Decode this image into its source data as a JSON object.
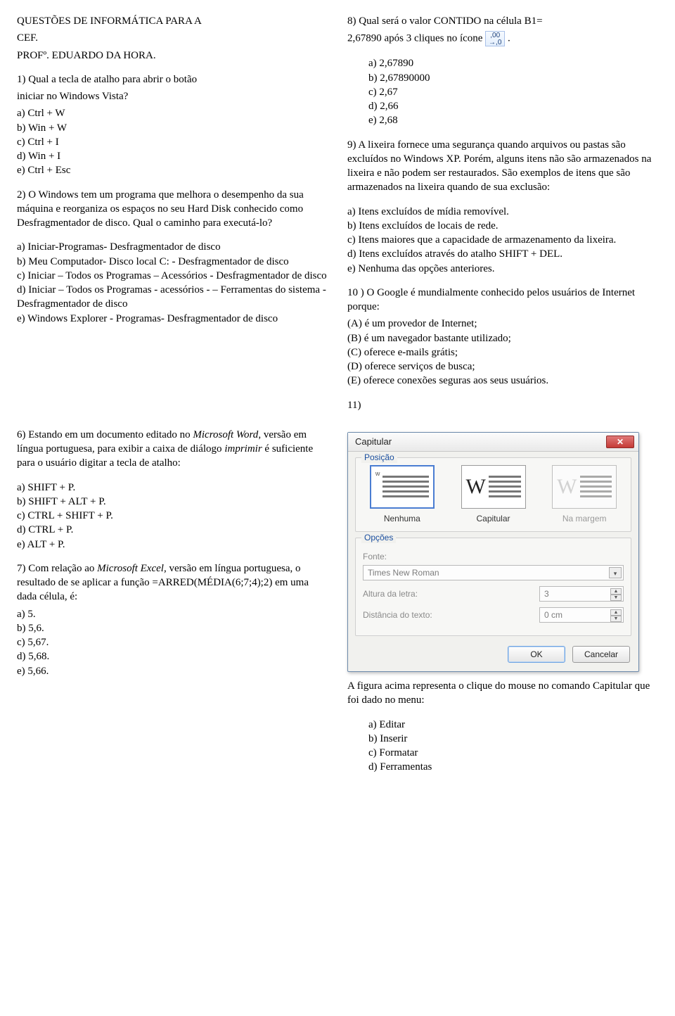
{
  "header": {
    "title_l1": "QUESTÕES DE INFORMÁTICA PARA A",
    "title_l2": "CEF.",
    "title_l3": "PROFº. EDUARDO DA HORA."
  },
  "q1": {
    "stem_l1": "1) Qual a tecla de atalho para abrir o botão",
    "stem_l2": "iniciar no Windows Vista?",
    "a": "a) Ctrl + W",
    "b": "b) Win + W",
    "c": "c) Ctrl + I",
    "d": "d) Win + I",
    "e": "e) Ctrl + Esc"
  },
  "q2": {
    "stem": "2) O Windows tem um programa que melhora o desempenho da sua máquina e reorganiza os espaços no seu Hard Disk conhecido como Desfragmentador de disco. Qual o caminho para executá-lo?",
    "a": "a) Iniciar-Programas- Desfragmentador de disco",
    "b": "b) Meu Computador- Disco local C: - Desfragmentador de disco",
    "c": "c) Iniciar – Todos os Programas – Acessórios - Desfragmentador de disco",
    "d": "d) Iniciar – Todos os Programas - acessórios - – Ferramentas do sistema - Desfragmentador de disco",
    "e": "e) Windows Explorer - Programas- Desfragmentador de disco"
  },
  "q6": {
    "stem_a": "6) Estando em um documento editado no ",
    "stem_i1": "Microsoft Word",
    "stem_b": ", versão em língua portuguesa, para exibir a caixa de diálogo ",
    "stem_i2": "imprimir",
    "stem_c": " é suficiente para o usuário digitar a tecla de atalho:",
    "a": "a) SHIFT + P.",
    "b": "b) SHIFT + ALT + P.",
    "c": "c) CTRL + SHIFT + P.",
    "d": "d) CTRL + P.",
    "e": "e) ALT + P."
  },
  "q7": {
    "stem_a": "7) Com relação ao ",
    "stem_i": "Microsoft Excel",
    "stem_b": ", versão em língua portuguesa, o resultado de se aplicar a função =ARRED(MÉDIA(6;7;4);2) em uma dada célula, é:",
    "a": "a) 5.",
    "b": "b) 5,6.",
    "c": "c) 5,67.",
    "d": "d) 5,68.",
    "e": "e) 5,66."
  },
  "q8": {
    "stem_l1": "8) Qual será o valor CONTIDO na célula B1=",
    "stem_l2a": "2,67890 após 3 cliques no ícone ",
    "stem_l2b": ".",
    "icon_top": ",00",
    "icon_bot": "→,0",
    "a": "a)   2,67890",
    "b": "b)   2,67890000",
    "c": "c)   2,67",
    "d": "d)   2,66",
    "e": "e)   2,68"
  },
  "q9": {
    "stem": "9) A lixeira fornece uma segurança quando arquivos ou pastas são excluídos no Windows XP. Porém, alguns itens não são armazenados na lixeira e não podem ser restaurados. São exemplos de itens que são armazenados na lixeira quando de sua exclusão:",
    "a": "a) Itens excluídos de mídia removível.",
    "b": "b) Itens excluídos de locais de rede.",
    "c": "c) Itens maiores que a capacidade de armazenamento da lixeira.",
    "d": "d) Itens excluídos através do atalho SHIFT + DEL.",
    "e": "e) Nenhuma das opções anteriores."
  },
  "q10": {
    "stem": "10 ) O Google é mundialmente conhecido pelos usuários de Internet porque:",
    "a": "(A) é um provedor de Internet;",
    "b": "(B) é um navegador bastante utilizado;",
    "c": "(C) oferece e-mails grátis;",
    "d": "(D) oferece serviços de busca;",
    "e": "(E) oferece conexões seguras aos seus usuários."
  },
  "q11": {
    "label": "11)",
    "after": "A figura acima representa o clique do mouse no comando Capitular que foi dado no menu:",
    "a": "a)   Editar",
    "b": "b)   Inserir",
    "c": "c)   Formatar",
    "d": "d)   Ferramentas"
  },
  "dlg": {
    "title": "Capitular",
    "grp_pos": "Posição",
    "pos_none": "Nenhuma",
    "pos_cap": "Capitular",
    "pos_margin": "Na margem",
    "w_char": "w",
    "grp_opt": "Opções",
    "lbl_font": "Fonte:",
    "val_font": "Times New Roman",
    "lbl_height": "Altura da letra:",
    "val_height": "3",
    "lbl_dist": "Distância do texto:",
    "val_dist": "0 cm",
    "ok": "OK",
    "cancel": "Cancelar"
  }
}
